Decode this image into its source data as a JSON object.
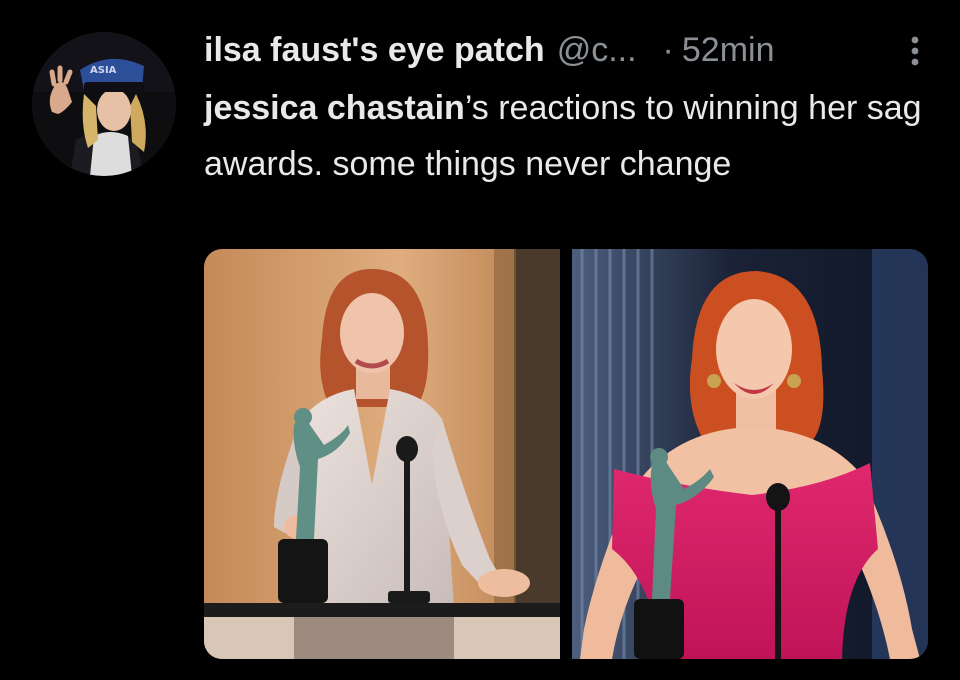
{
  "tweet": {
    "display_name": "ilsa faust's eye patch",
    "handle": "@c...",
    "separator": "·",
    "time": "52min",
    "text_mention": "jessica chastain",
    "text_body": "’s reactions to winning her sag awards. some things never change"
  },
  "avatar": {
    "hat_text": "ASIA"
  },
  "media": {
    "count": 2
  },
  "colors": {
    "background": "#000000",
    "text": "#e7e9ea",
    "secondary_text": "#8b9096"
  },
  "icons": {
    "more": "vertical-ellipsis-icon"
  }
}
